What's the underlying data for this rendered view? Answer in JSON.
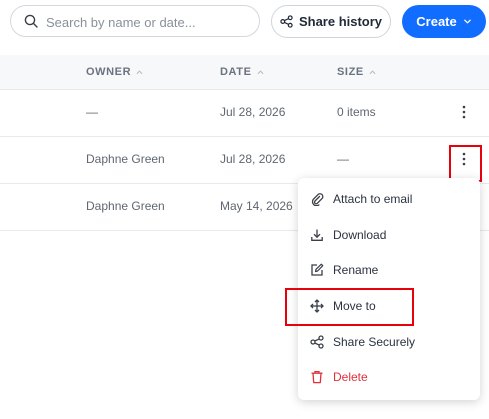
{
  "search": {
    "placeholder": "Search by name or date..."
  },
  "toolbar": {
    "share_history_label": "Share history",
    "create_label": "Create"
  },
  "table": {
    "columns": [
      {
        "label": "OWNER"
      },
      {
        "label": "DATE"
      },
      {
        "label": "SIZE"
      }
    ],
    "rows": [
      {
        "owner": "—",
        "date": "Jul 28, 2026",
        "size": "0 items"
      },
      {
        "owner": "Daphne Green",
        "date": "Jul 28, 2026",
        "size": "—"
      },
      {
        "owner": "Daphne Green",
        "date": "May 14, 2026",
        "size": ""
      }
    ]
  },
  "context_menu": {
    "items": [
      {
        "label": "Attach to email",
        "icon": "paperclip-icon"
      },
      {
        "label": "Download",
        "icon": "download-icon"
      },
      {
        "label": "Rename",
        "icon": "edit-icon"
      },
      {
        "label": "Move to",
        "icon": "move-icon"
      },
      {
        "label": "Share Securely",
        "icon": "share-icon"
      },
      {
        "label": "Delete",
        "icon": "trash-icon"
      }
    ]
  },
  "colors": {
    "primary": "#116dff",
    "danger": "#e0303c",
    "highlight": "#e8000b"
  }
}
